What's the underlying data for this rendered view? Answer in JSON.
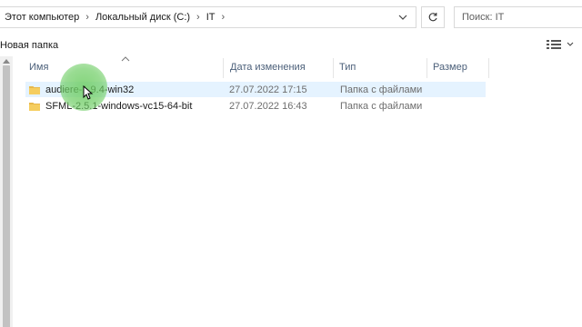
{
  "address_bar": {
    "crumbs": [
      "Этот компьютер",
      "Локальный диск (C:)",
      "IT"
    ]
  },
  "search": {
    "placeholder": "Поиск: IT"
  },
  "toolbar": {
    "new_folder_label": "Новая папка"
  },
  "columns": {
    "name": "Имя",
    "date": "Дата изменения",
    "type": "Тип",
    "size": "Размер"
  },
  "files": [
    {
      "name": "audiere-1.9.4-win32",
      "date": "27.07.2022 17:15",
      "type": "Папка с файлами",
      "selected": true
    },
    {
      "name": "SFML-2.5.1-windows-vc15-64-bit",
      "date": "27.07.2022 16:43",
      "type": "Папка с файлами",
      "selected": false
    }
  ],
  "icons": [
    "chevron-right-icon",
    "chevron-down-icon",
    "refresh-icon",
    "folder-icon",
    "view-details-icon",
    "sort-up-icon",
    "mouse-cursor-icon"
  ],
  "colors": {
    "selection": "#e5f3ff",
    "folder": "#e8b84a",
    "header_text": "#4c607a",
    "click_highlight": "#6ecd64"
  }
}
